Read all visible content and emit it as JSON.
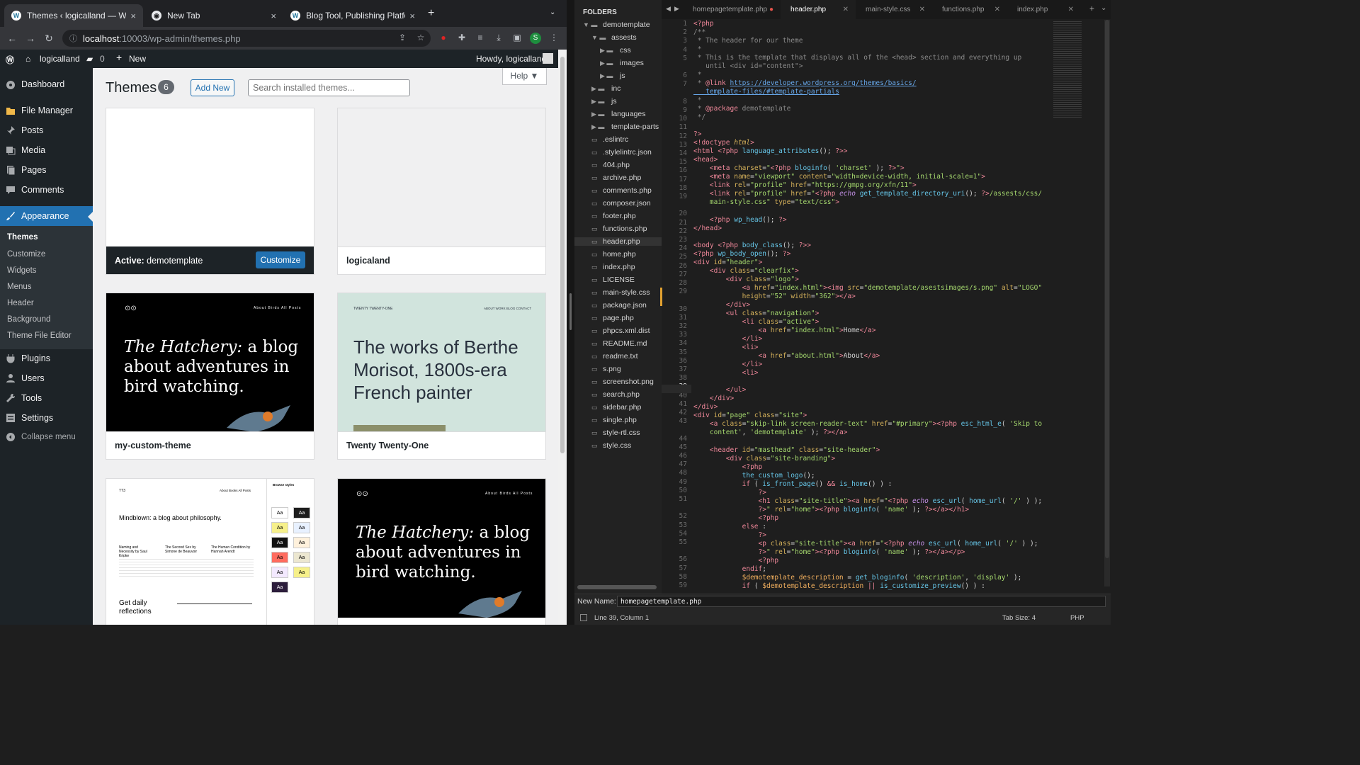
{
  "browser": {
    "tabs": [
      {
        "title": "Themes ‹ logicalland — WordP",
        "close": "×"
      },
      {
        "title": "New Tab",
        "close": "×"
      },
      {
        "title": "Blog Tool, Publishing Platform,",
        "close": "×"
      }
    ],
    "new_tab": "+",
    "url_host": "localhost",
    "url_path": ":10003/wp-admin/themes.php",
    "profile_initial": "S"
  },
  "adminbar": {
    "site": "logicalland",
    "comments": "0",
    "new": "New",
    "howdy": "Howdy, logicalland"
  },
  "menu": {
    "items": [
      {
        "label": "Dashboard"
      },
      {
        "label": "File Manager"
      },
      {
        "label": "Posts"
      },
      {
        "label": "Media"
      },
      {
        "label": "Pages"
      },
      {
        "label": "Comments"
      },
      {
        "label": "Appearance"
      },
      {
        "label": "Plugins"
      },
      {
        "label": "Users"
      },
      {
        "label": "Tools"
      },
      {
        "label": "Settings"
      },
      {
        "label": "Collapse menu"
      }
    ],
    "submenu": [
      "Themes",
      "Customize",
      "Widgets",
      "Menus",
      "Header",
      "Background",
      "Theme File Editor"
    ]
  },
  "themes_page": {
    "title": "Themes",
    "count": "6",
    "add_new": "Add New",
    "search_placeholder": "Search installed themes...",
    "help": "Help ▼",
    "active_prefix": "Active:",
    "active_name": "demotemplate",
    "customize": "Customize",
    "cards": [
      {
        "name": "logicaland"
      },
      {
        "name": "my-custom-theme"
      },
      {
        "name": "Twenty Twenty-One"
      }
    ],
    "previews": {
      "hatchery_italic": "The Hatchery:",
      "hatchery_line1": " a blog",
      "hatchery_line2": "about adventures in",
      "hatchery_line3": "bird watching.",
      "hatchery_nav": "About   Birds   All Posts",
      "tt1_brand": "TWENTY TWENTY-ONE",
      "tt1_nav": "ABOUT   WORK   BLOG   CONTACT",
      "tt1_headline": "The works of Berthe Morisot, 1800s-era French painter",
      "tt3_brand": "TT3",
      "tt3_nav": "About   Books   All Posts",
      "tt3_headline": "Mindblown: a blog about philosophy.",
      "tt3_books": [
        "Naming and Necessity by Saul Kripke",
        "The Second Sex by Simone de Beauvoir",
        "The Human Condition by Hannah Arendt"
      ],
      "tt3_footer": "Get daily reflections",
      "tt3_styles_title": "Browse styles",
      "tt3_swatch": "Aa"
    }
  },
  "editor": {
    "folders_title": "FOLDERS",
    "tabs": [
      "homepagetemplate.php",
      "header.php",
      "main-style.css",
      "functions.php",
      "index.php"
    ],
    "tree": [
      "demotemplate",
      "assests",
      "css",
      "images",
      "js",
      "inc",
      "js",
      "languages",
      "template-parts",
      ".eslintrc",
      ".stylelintrc.json",
      "404.php",
      "archive.php",
      "comments.php",
      "composer.json",
      "footer.php",
      "functions.php",
      "header.php",
      "home.php",
      "index.php",
      "LICENSE",
      "main-style.css",
      "package.json",
      "page.php",
      "phpcs.xml.dist",
      "README.md",
      "readme.txt",
      "s.png",
      "screenshot.png",
      "search.php",
      "sidebar.php",
      "single.php",
      "style-rtl.css",
      "style.css"
    ],
    "line_numbers": [
      "1",
      "2",
      "3",
      "4",
      "5",
      "",
      "6",
      "7",
      "",
      "8",
      "9",
      "10",
      "11",
      "12",
      "13",
      "14",
      "15",
      "16",
      "17",
      "18",
      "19",
      "",
      "20",
      "21",
      "22",
      "23",
      "24",
      "25",
      "26",
      "27",
      "28",
      "29",
      "",
      "30",
      "31",
      "32",
      "33",
      "34",
      "35",
      "36",
      "37",
      "38",
      "39",
      "40",
      "41",
      "42",
      "43",
      "",
      "44",
      "45",
      "46",
      "47",
      "48",
      "49",
      "50",
      "51",
      "",
      "52",
      "53",
      "54",
      "55",
      "",
      "56",
      "57",
      "58",
      "59"
    ],
    "new_name_label": "New Name:",
    "new_name_value": "homepagetemplate.php",
    "status_pos": "Line 39, Column 1",
    "tab_size": "Tab Size: 4",
    "syntax": "PHP"
  }
}
